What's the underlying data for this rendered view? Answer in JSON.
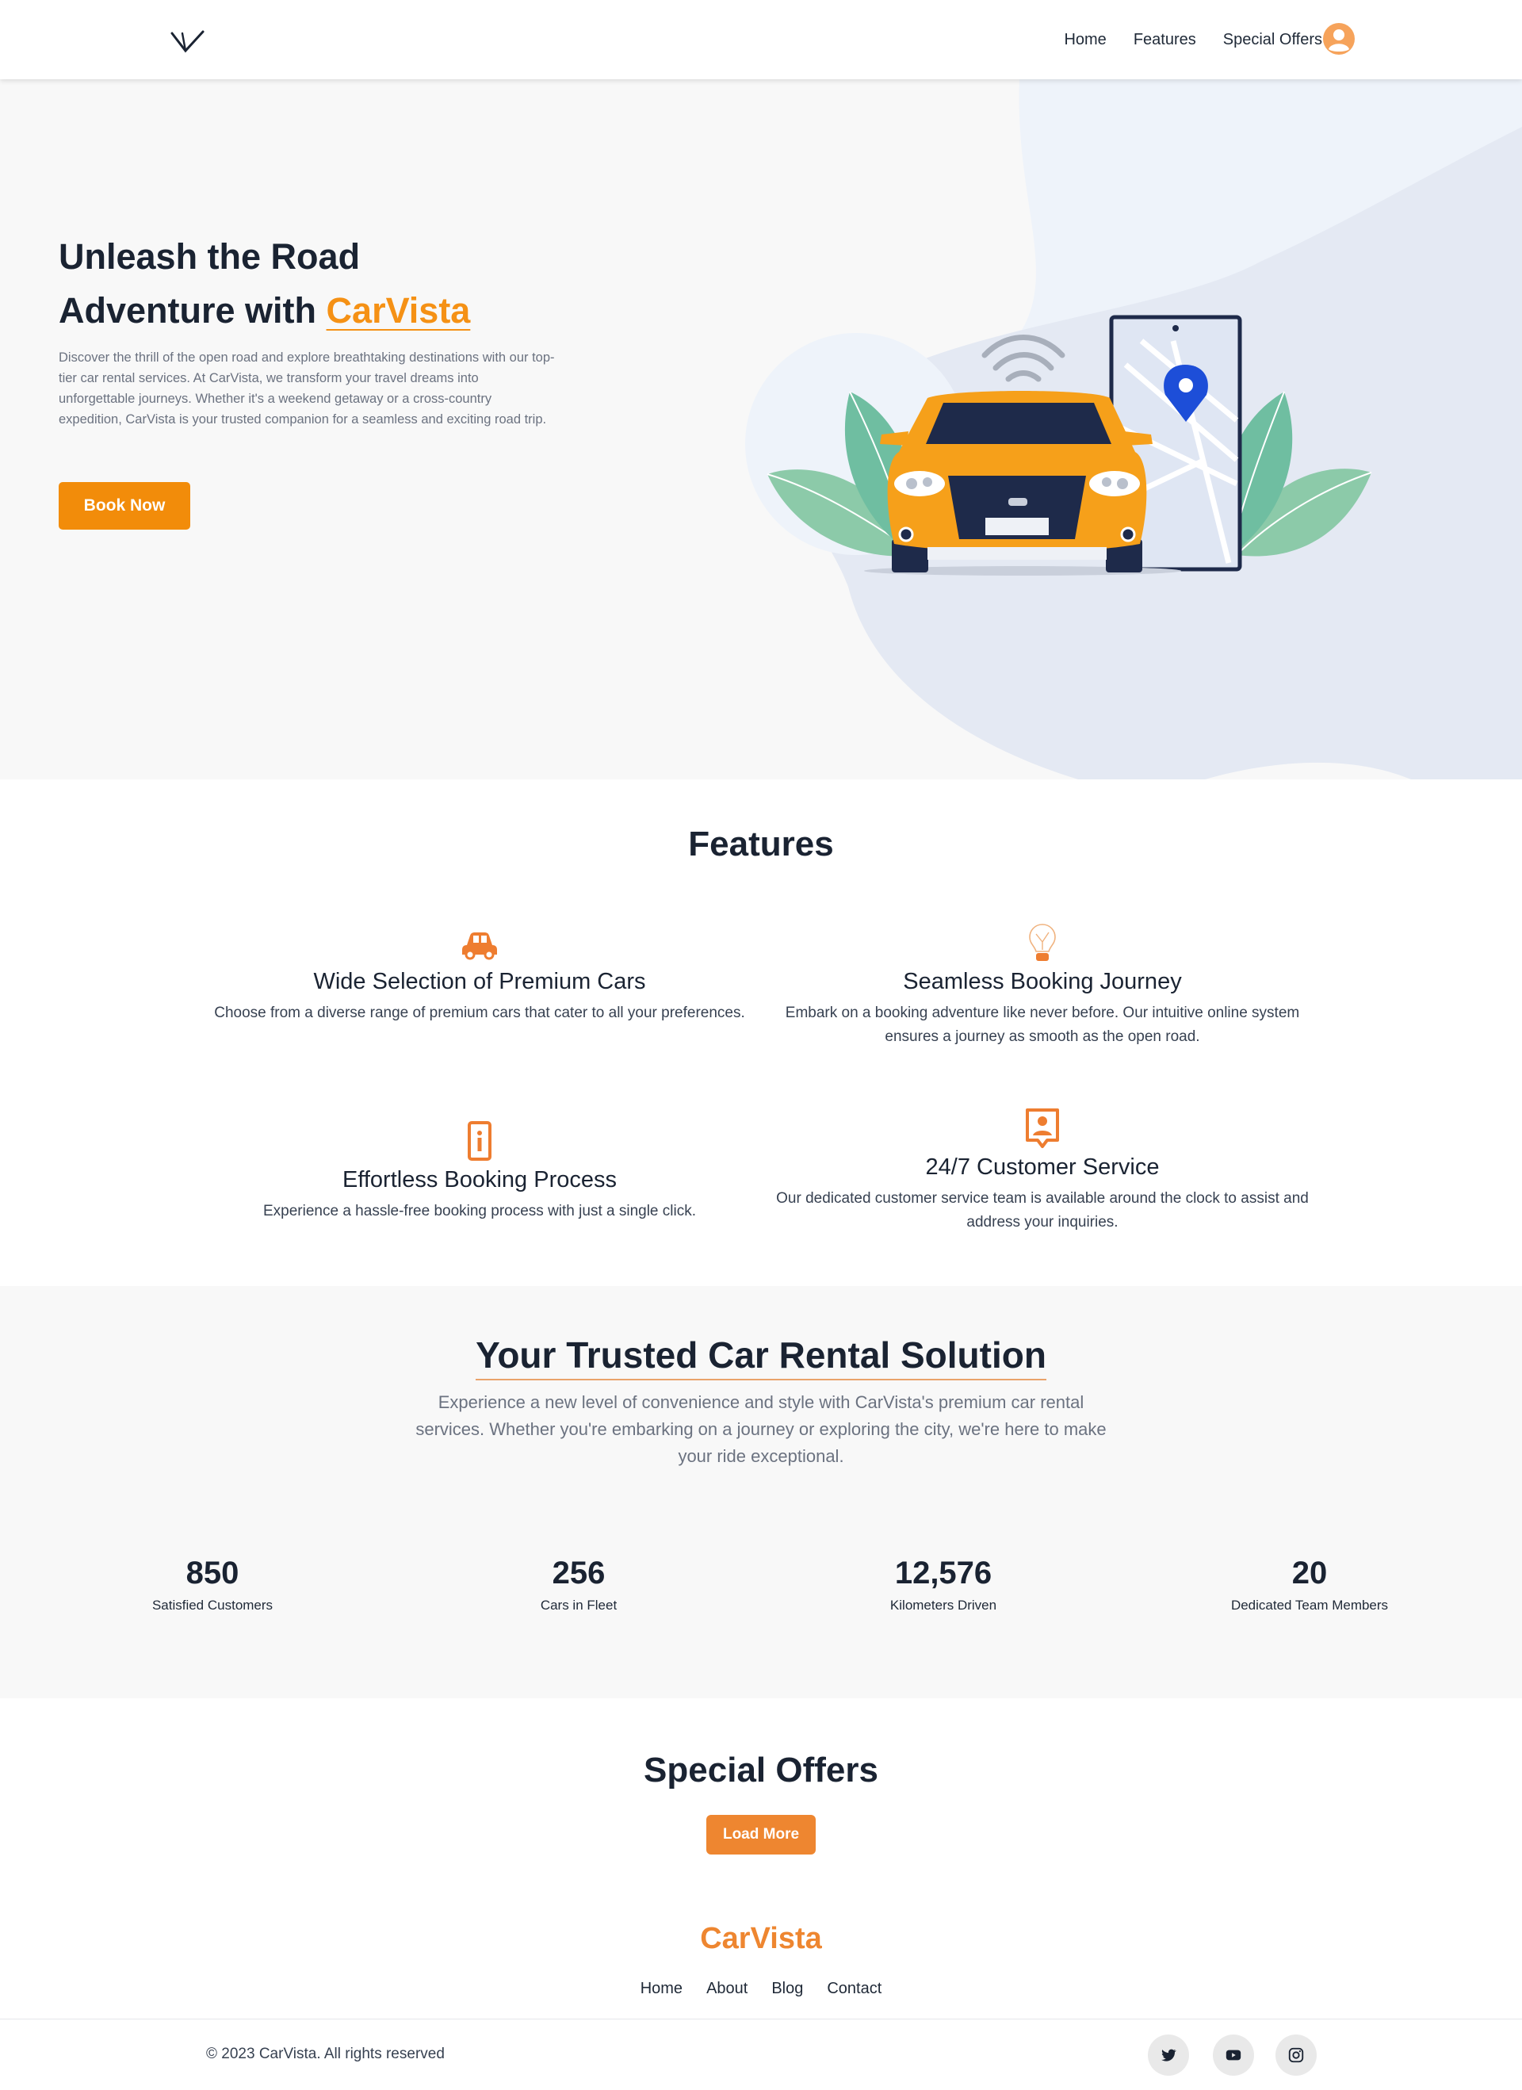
{
  "nav": {
    "links": [
      "Home",
      "Features",
      "Special Offers"
    ],
    "logo_icon": "v-logo-icon",
    "avatar_icon": "user-avatar-icon"
  },
  "hero": {
    "title_line1": "Unleash the Road",
    "title_line2_prefix": "Adventure with",
    "title_brand": "CarVista",
    "description": "Discover the thrill of the open road and explore breathtaking destinations with our top-tier car rental services. At CarVista, we transform your travel dreams into unforgettable journeys. Whether it's a weekend getaway or a cross-country expedition, CarVista is your trusted companion for a seamless and exciting road trip.",
    "cta_label": "Book Now"
  },
  "features": {
    "title": "Features",
    "items": [
      {
        "title": "Wide Selection of Premium Cars",
        "description": "Choose from a diverse range of premium cars that cater to all your preferences.",
        "icon": "car-icon"
      },
      {
        "title": "Seamless Booking Journey",
        "description": "Embark on a booking adventure like never before. Our intuitive online system ensures a journey as smooth as the open road.",
        "icon": "lightbulb-icon"
      },
      {
        "title": "Effortless Booking Process",
        "description": "Experience a hassle-free booking process with just a single click.",
        "icon": "info-device-icon"
      },
      {
        "title": "24/7 Customer Service",
        "description": "Our dedicated customer service team is available around the clock to assist and address your inquiries.",
        "icon": "support-agent-icon"
      }
    ]
  },
  "trusted": {
    "title": "Your Trusted Car Rental Solution",
    "description": "Experience a new level of convenience and style with CarVista's premium car rental services. Whether you're embarking on a journey or exploring the city, we're here to make your ride exceptional.",
    "stats": [
      {
        "value": "850",
        "label": "Satisfied Customers"
      },
      {
        "value": "256",
        "label": "Cars in Fleet"
      },
      {
        "value": "12,576",
        "label": "Kilometers Driven"
      },
      {
        "value": "20",
        "label": "Dedicated Team Members"
      }
    ]
  },
  "offers": {
    "title": "Special Offers",
    "load_more_label": "Load More"
  },
  "footer": {
    "brand": "CarVista",
    "links": [
      "Home",
      "About",
      "Blog",
      "Contact"
    ],
    "copyright": "© 2023 CarVista. All rights reserved",
    "social_icons": [
      "twitter-icon",
      "youtube-icon",
      "instagram-icon"
    ]
  },
  "colors": {
    "accent": "#f28c0a",
    "accent_soft": "#ee8630",
    "text_dark": "#1a2332",
    "text_muted": "#6b7280",
    "section_bg": "#f8f8f8"
  }
}
